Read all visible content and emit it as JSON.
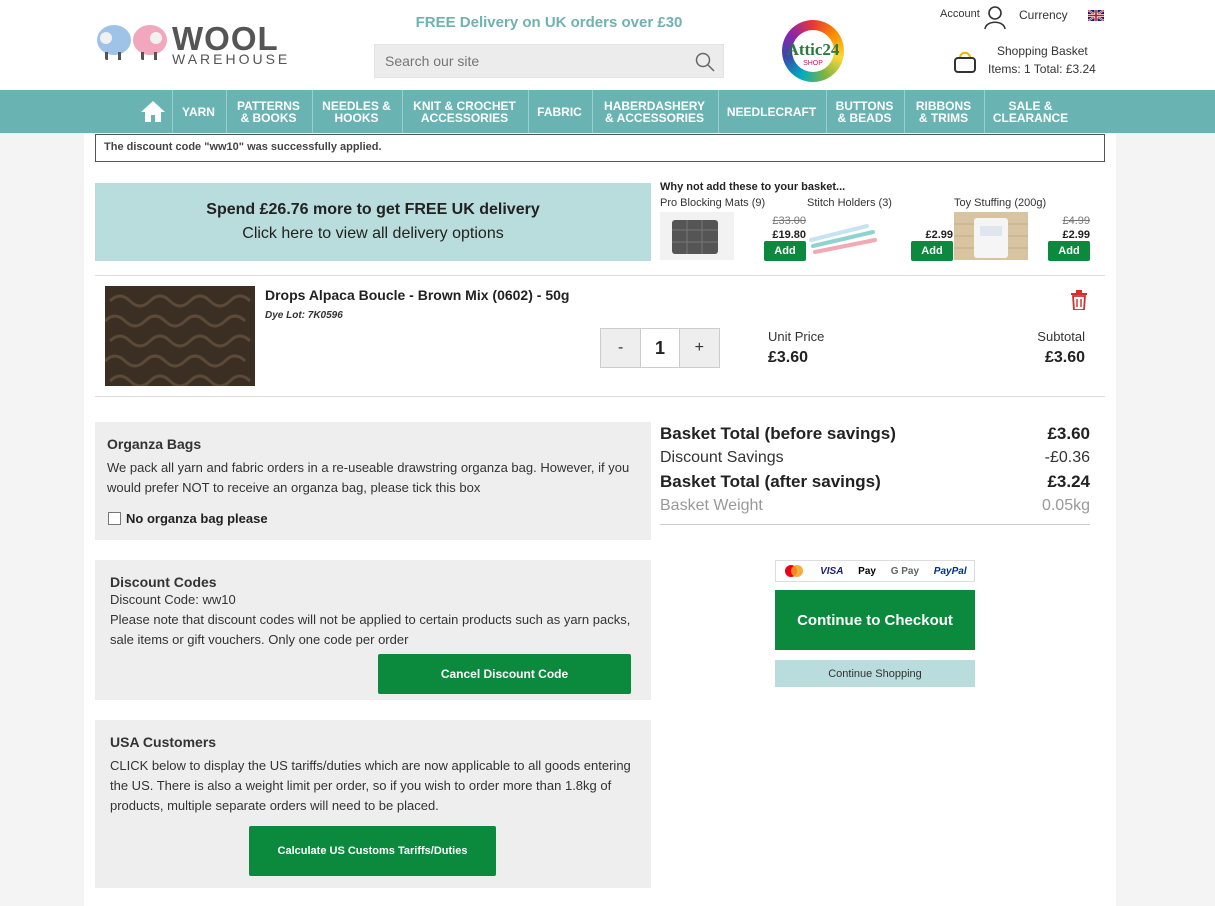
{
  "header": {
    "logo_word1": "WOOL",
    "logo_word2": "WAREHOUSE",
    "promo": "FREE Delivery on UK orders over £30",
    "search_placeholder": "Search our site",
    "attic_name": "Attic24",
    "attic_shop": "SHOP",
    "account_label": "Account",
    "currency_label": "Currency",
    "basket_title": "Shopping Basket",
    "basket_info": "Items: 1 Total: £3.24"
  },
  "nav": [
    {
      "label": "YARN"
    },
    {
      "label": "PATTERNS\n& BOOKS"
    },
    {
      "label": "NEEDLES &\nHOOKS"
    },
    {
      "label": "KNIT & CROCHET\nACCESSORIES"
    },
    {
      "label": "FABRIC"
    },
    {
      "label": "HABERDASHERY\n& ACCESSORIES"
    },
    {
      "label": "NEEDLECRAFT"
    },
    {
      "label": "BUTTONS\n& BEADS"
    },
    {
      "label": "RIBBONS\n& TRIMS"
    },
    {
      "label": "SALE &\nCLEARANCE"
    }
  ],
  "notice": "The discount code \"ww10\" was successfully applied.",
  "delivery": {
    "headline": "Spend £26.76 more to get FREE UK delivery",
    "subline": "Click here to view all delivery options"
  },
  "upsell": {
    "title": "Why not add these to your basket...",
    "items": [
      {
        "name": "Pro Blocking Mats (9)",
        "old_price": "£33.00",
        "price": "£19.80",
        "button": "Add"
      },
      {
        "name": "Stitch Holders (3)",
        "old_price": "",
        "price": "£2.99",
        "button": "Add"
      },
      {
        "name": "Toy Stuffing (200g)",
        "old_price": "£4.99",
        "price": "£2.99",
        "button": "Add"
      }
    ]
  },
  "product": {
    "name": "Drops Alpaca Boucle - Brown Mix (0602) - 50g",
    "dye_lot": "Dye Lot: 7K0596",
    "qty_minus": "-",
    "qty": "1",
    "qty_plus": "+",
    "unit_price_label": "Unit Price",
    "unit_price": "£3.60",
    "subtotal_label": "Subtotal",
    "subtotal": "£3.60"
  },
  "organza": {
    "title": "Organza Bags",
    "text": "We pack all yarn and fabric orders in a re-useable drawstring organza bag. However, if you would prefer NOT to receive an organza bag, please tick this box",
    "checkbox_label": "No organza bag please"
  },
  "discount": {
    "title": "Discount Codes",
    "code_line": "Discount Code: ww10",
    "text": "Please note that discount codes will not be applied to certain products such as yarn packs, sale items or gift vouchers. Only one code per order",
    "button": "Cancel Discount Code"
  },
  "usa": {
    "title": "USA Customers",
    "text": "CLICK below to display the US tariffs/duties which are now applicable to all goods entering the US. There is also a weight limit per order, so if you wish to order more than 1.8kg of products, multiple separate orders will need to be placed.",
    "button": "Calculate US Customs Tariffs/Duties"
  },
  "totals": {
    "before_label": "Basket Total (before savings)",
    "before_value": "£3.60",
    "discount_label": "Discount Savings",
    "discount_value": "-£0.36",
    "after_label": "Basket Total (after savings)",
    "after_value": "£3.24",
    "weight_label": "Basket Weight",
    "weight_value": "0.05kg"
  },
  "payments": [
    "VISA",
    "Pay",
    "G Pay",
    "PayPal"
  ],
  "checkout_button": "Continue to Checkout",
  "continue_shopping": "Continue Shopping",
  "colors": {
    "teal": "#6ab3b3",
    "light_teal": "#b9dcdc",
    "green": "#0b8a3e"
  }
}
